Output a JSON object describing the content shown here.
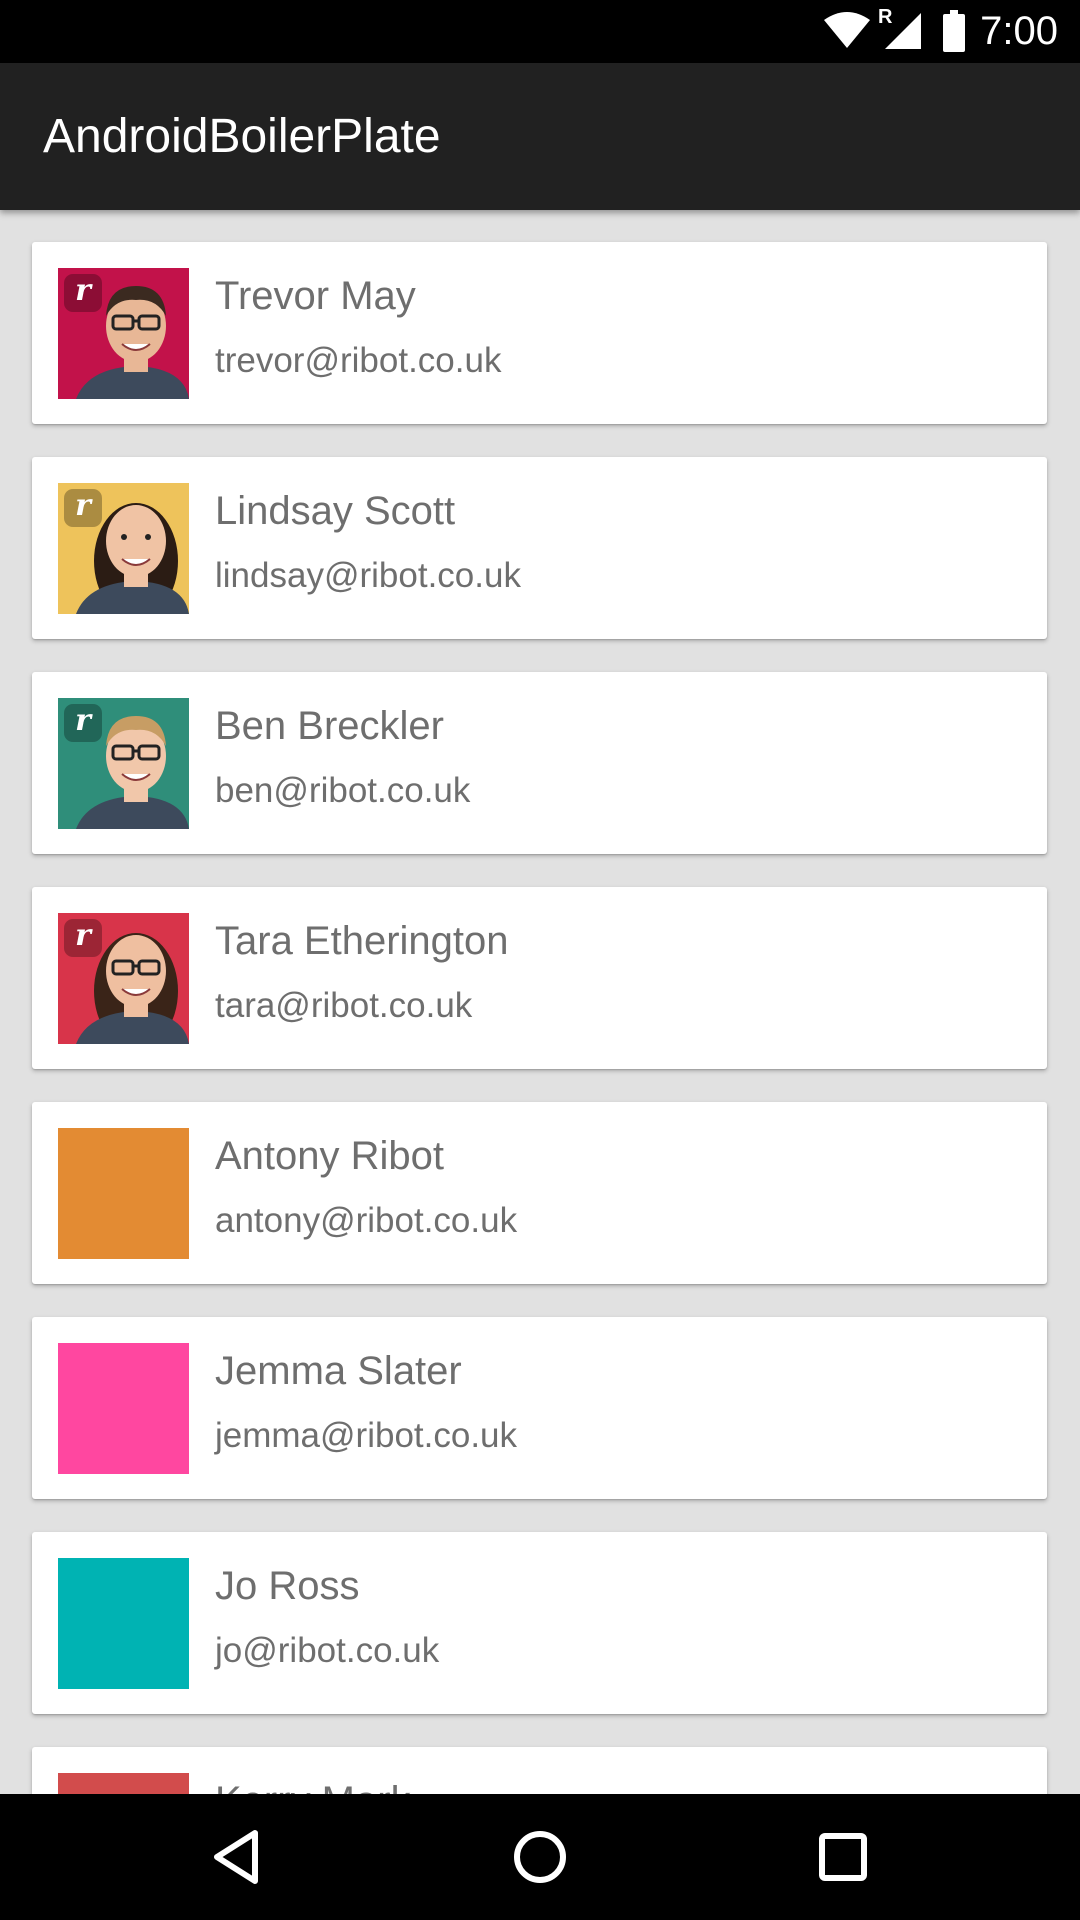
{
  "status_bar": {
    "time": "7:00",
    "network_badge": "R",
    "icons": [
      "wifi-icon",
      "cell-signal-icon",
      "battery-icon"
    ]
  },
  "app_bar": {
    "title": "AndroidBoilerPlate"
  },
  "ribot_badge": "r",
  "people": [
    {
      "name": "Trevor May",
      "email": "trevor@ribot.co.uk",
      "color": "#c2124a",
      "photo": true
    },
    {
      "name": "Lindsay Scott",
      "email": "lindsay@ribot.co.uk",
      "color": "#eec35b",
      "photo": true
    },
    {
      "name": "Ben Breckler",
      "email": "ben@ribot.co.uk",
      "color": "#2f8e7a",
      "photo": true
    },
    {
      "name": "Tara Etherington",
      "email": "tara@ribot.co.uk",
      "color": "#d8344a",
      "photo": true
    },
    {
      "name": "Antony Ribot",
      "email": "antony@ribot.co.uk",
      "color": "#e38b33",
      "photo": false
    },
    {
      "name": "Jemma Slater",
      "email": "jemma@ribot.co.uk",
      "color": "#ff47a0",
      "photo": false
    },
    {
      "name": "Jo Ross",
      "email": "jo@ribot.co.uk",
      "color": "#00b3b3",
      "photo": false
    },
    {
      "name": "Kerry Mark",
      "email": "",
      "color": "#d24c4c",
      "photo": false
    }
  ],
  "nav_bar": {
    "icons": [
      "back-icon",
      "home-icon",
      "recents-icon"
    ]
  }
}
